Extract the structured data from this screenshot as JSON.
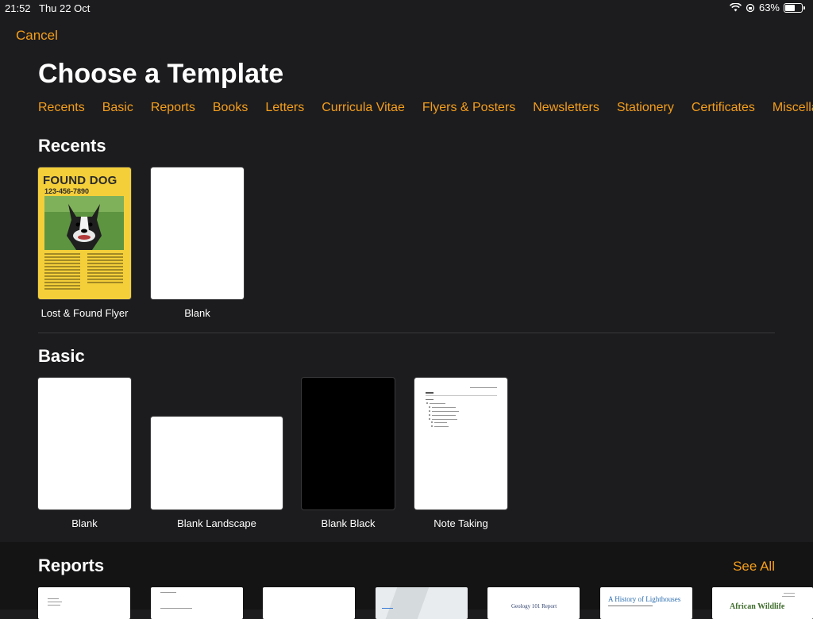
{
  "status": {
    "time": "21:52",
    "date": "Thu 22 Oct",
    "battery": "63%"
  },
  "nav": {
    "cancel": "Cancel"
  },
  "page": {
    "title": "Choose a Template"
  },
  "categories": [
    "Recents",
    "Basic",
    "Reports",
    "Books",
    "Letters",
    "Curricula Vitae",
    "Flyers & Posters",
    "Newsletters",
    "Stationery",
    "Certificates",
    "Miscellaneous"
  ],
  "sections": {
    "recents": {
      "title": "Recents",
      "items": [
        {
          "label": "Lost & Found Flyer",
          "title_text": "FOUND DOG",
          "phone": "123-456-7890"
        },
        {
          "label": "Blank"
        }
      ]
    },
    "basic": {
      "title": "Basic",
      "items": [
        {
          "label": "Blank"
        },
        {
          "label": "Blank Landscape"
        },
        {
          "label": "Blank Black"
        },
        {
          "label": "Note Taking"
        }
      ]
    },
    "reports": {
      "title": "Reports",
      "see_all": "See All",
      "thumb_titles": [
        "Geology 101 Report",
        "A History of Lighthouses",
        "African Wildlife"
      ]
    }
  },
  "colors": {
    "accent": "#f59e1b",
    "background": "#1c1c1e",
    "flyer_yellow": "#f4cf3a"
  }
}
